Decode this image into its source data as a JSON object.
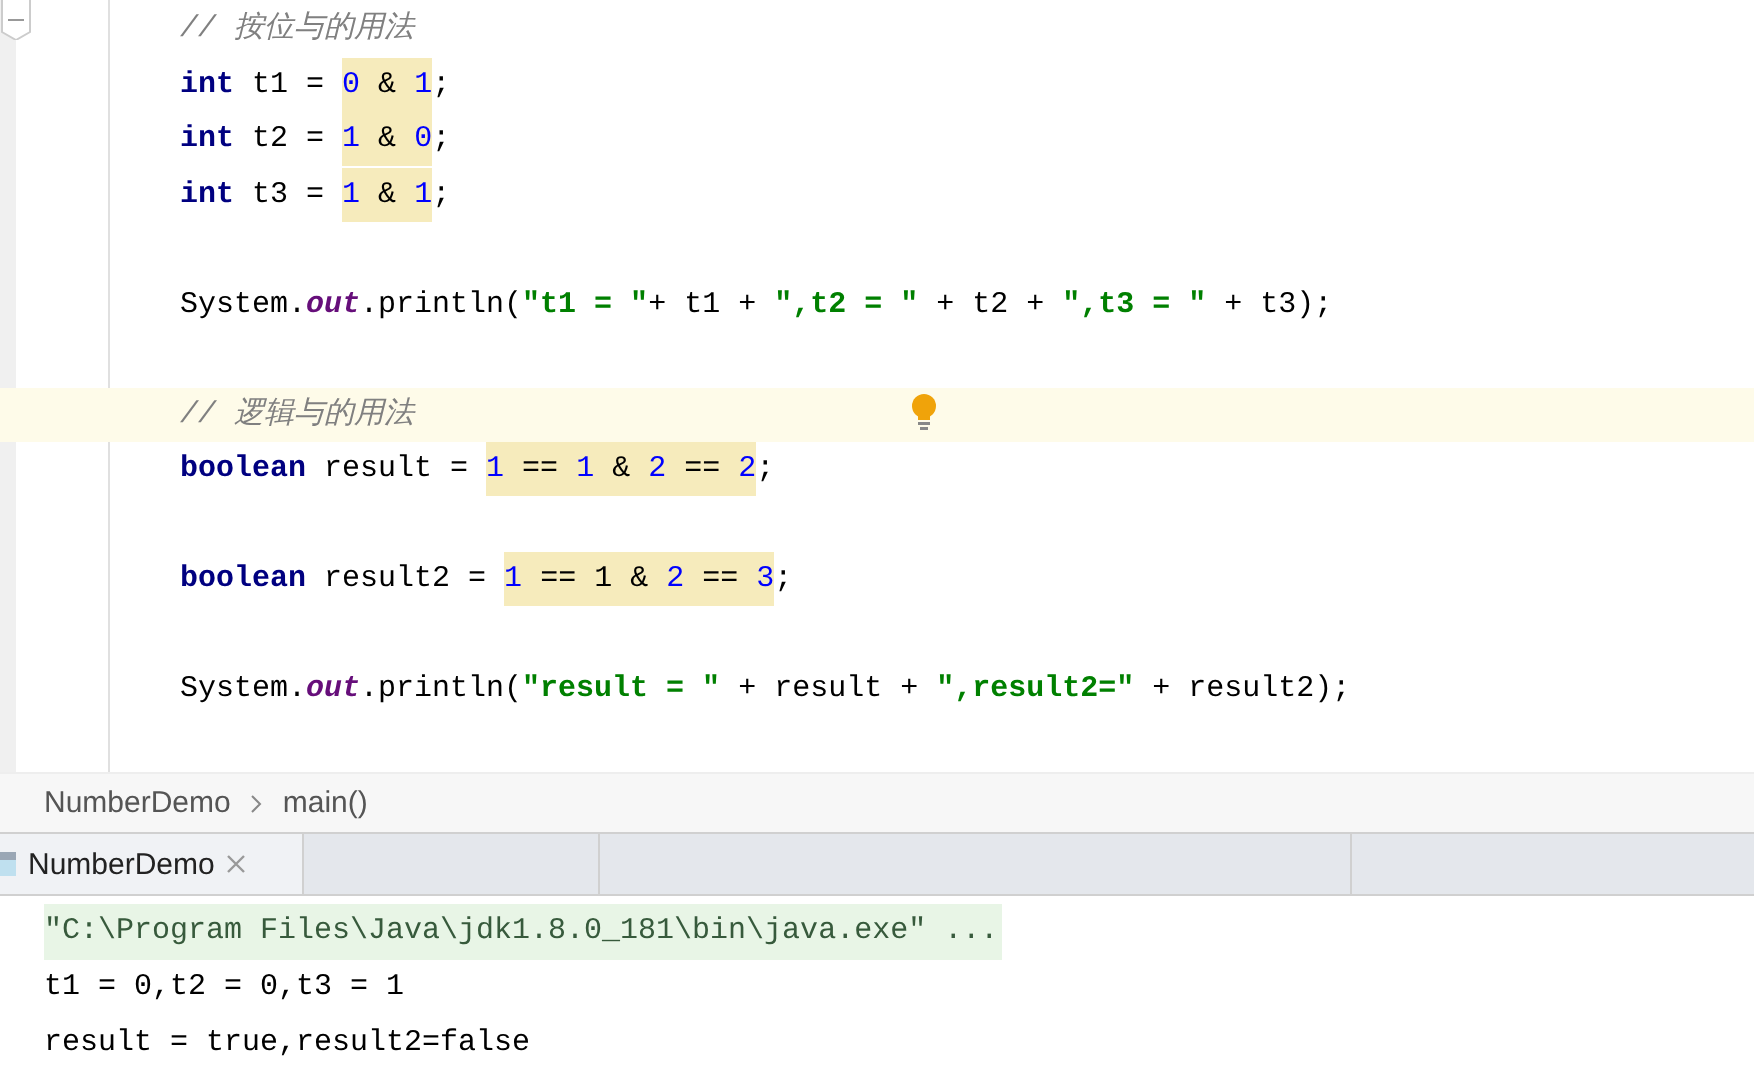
{
  "editor": {
    "lines": [
      {
        "current": false,
        "tokens": [
          {
            "kind": "comment",
            "text": "// 按位与的用法"
          }
        ]
      },
      {
        "current": false,
        "tokens": [
          {
            "kind": "keyword",
            "text": "int"
          },
          {
            "kind": "plain",
            "text": " t1 = "
          },
          {
            "kind": "match",
            "tokens": [
              {
                "kind": "number",
                "text": "0"
              },
              {
                "kind": "plain",
                "text": " & "
              },
              {
                "kind": "number",
                "text": "1"
              }
            ]
          },
          {
            "kind": "plain",
            "text": ";"
          }
        ]
      },
      {
        "current": false,
        "tokens": [
          {
            "kind": "keyword",
            "text": "int"
          },
          {
            "kind": "plain",
            "text": " t2 = "
          },
          {
            "kind": "match",
            "tokens": [
              {
                "kind": "number",
                "text": "1"
              },
              {
                "kind": "plain",
                "text": " & "
              },
              {
                "kind": "number",
                "text": "0"
              }
            ]
          },
          {
            "kind": "plain",
            "text": ";"
          }
        ]
      },
      {
        "current": false,
        "tokens": [
          {
            "kind": "keyword",
            "text": "int"
          },
          {
            "kind": "plain",
            "text": " t3 = "
          },
          {
            "kind": "match",
            "tokens": [
              {
                "kind": "number",
                "text": "1"
              },
              {
                "kind": "plain",
                "text": " & "
              },
              {
                "kind": "number",
                "text": "1"
              }
            ]
          },
          {
            "kind": "plain",
            "text": ";"
          }
        ]
      },
      {
        "current": false
      },
      {
        "current": false,
        "tokens": [
          {
            "kind": "plain",
            "text": "System."
          },
          {
            "kind": "field",
            "text": "out"
          },
          {
            "kind": "plain",
            "text": ".println("
          },
          {
            "kind": "string",
            "text": "\"t1 = \""
          },
          {
            "kind": "plain",
            "text": "+ t1 + "
          },
          {
            "kind": "string",
            "text": "\",t2 = \""
          },
          {
            "kind": "plain",
            "text": " + t2 + "
          },
          {
            "kind": "string",
            "text": "\",t3 = \""
          },
          {
            "kind": "plain",
            "text": " + t3);"
          }
        ]
      },
      {
        "current": false
      },
      {
        "current": true,
        "bulb": true,
        "tokens": [
          {
            "kind": "comment",
            "text": "// 逻辑与的用法"
          }
        ]
      },
      {
        "current": false,
        "tokens": [
          {
            "kind": "keyword",
            "text": "boolean"
          },
          {
            "kind": "plain",
            "text": " result = "
          },
          {
            "kind": "match",
            "tokens": [
              {
                "kind": "number",
                "text": "1"
              },
              {
                "kind": "plain",
                "text": " == "
              },
              {
                "kind": "number",
                "text": "1"
              },
              {
                "kind": "plain",
                "text": " & "
              },
              {
                "kind": "number",
                "text": "2"
              },
              {
                "kind": "plain",
                "text": " == "
              },
              {
                "kind": "number",
                "text": "2"
              }
            ]
          },
          {
            "kind": "plain",
            "text": ";"
          }
        ]
      },
      {
        "current": false
      },
      {
        "current": false,
        "tokens": [
          {
            "kind": "keyword",
            "text": "boolean"
          },
          {
            "kind": "plain",
            "text": " result2 = "
          },
          {
            "kind": "match",
            "tokens": [
              {
                "kind": "number",
                "text": "1"
              },
              {
                "kind": "plain",
                "text": " == 1 & "
              },
              {
                "kind": "number",
                "text": "2"
              },
              {
                "kind": "plain",
                "text": " == "
              },
              {
                "kind": "number",
                "text": "3"
              }
            ]
          },
          {
            "kind": "plain",
            "text": ";"
          }
        ]
      },
      {
        "current": false
      },
      {
        "current": false,
        "tokens": [
          {
            "kind": "plain",
            "text": "System."
          },
          {
            "kind": "field",
            "text": "out"
          },
          {
            "kind": "plain",
            "text": ".println("
          },
          {
            "kind": "string",
            "text": "\"result = \""
          },
          {
            "kind": "plain",
            "text": " + result + "
          },
          {
            "kind": "string",
            "text": "\",result2=\""
          },
          {
            "kind": "plain",
            "text": " + result2);"
          }
        ]
      }
    ]
  },
  "breadcrumb": [
    "NumberDemo",
    "main()"
  ],
  "run_tabs": [
    {
      "label": "NumberDemo",
      "selected": true
    }
  ],
  "console": [
    {
      "kind": "command",
      "text": "\"C:\\Program Files\\Java\\jdk1.8.0_181\\bin\\java.exe\" ..."
    },
    {
      "kind": "output",
      "text": "t1 = 0,t2 = 0,t3 = 1"
    },
    {
      "kind": "output",
      "text": "result = true,result2=false"
    }
  ]
}
